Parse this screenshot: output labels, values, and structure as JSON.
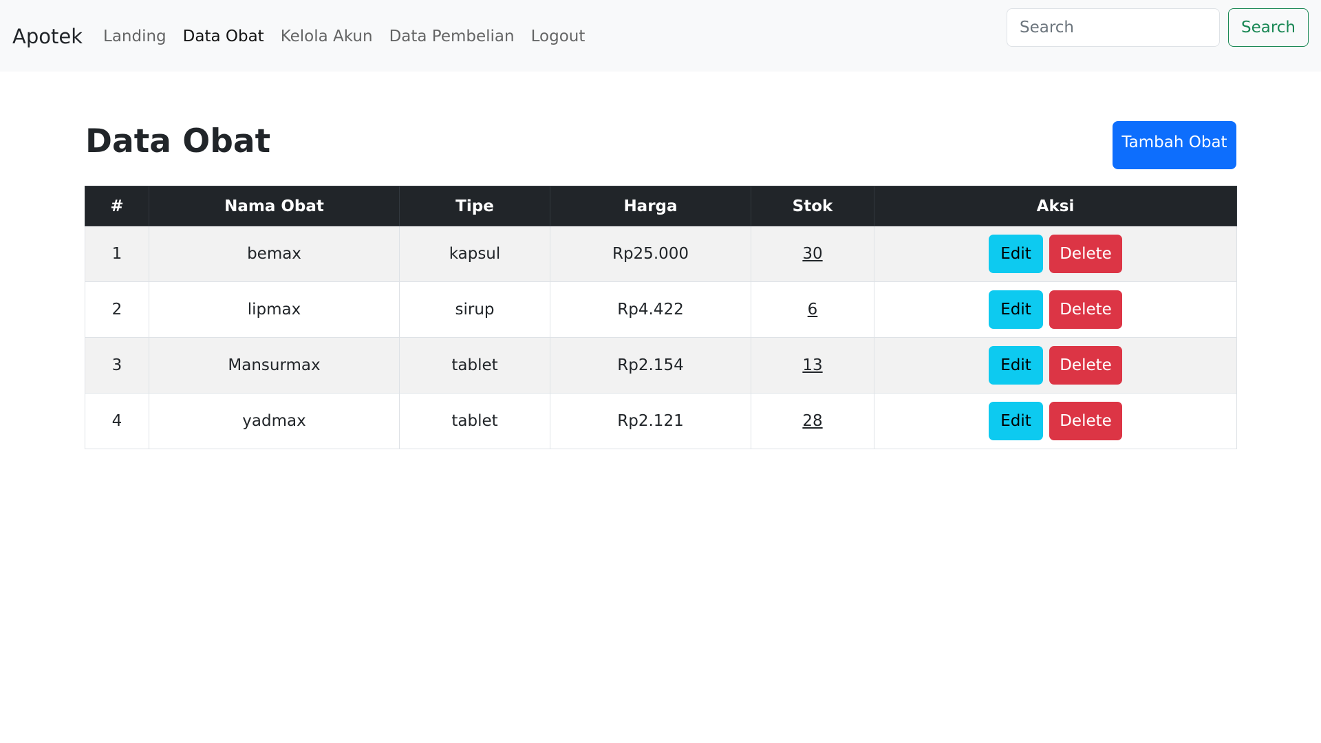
{
  "navbar": {
    "brand": "Apotek",
    "links": [
      {
        "label": "Landing",
        "active": false
      },
      {
        "label": "Data Obat",
        "active": true
      },
      {
        "label": "Kelola Akun",
        "active": false
      },
      {
        "label": "Data Pembelian",
        "active": false
      },
      {
        "label": "Logout",
        "active": false
      }
    ],
    "search_placeholder": "Search",
    "search_button": "Search"
  },
  "main": {
    "title": "Data Obat",
    "add_button": "Tambah Obat"
  },
  "table": {
    "headers": [
      "#",
      "Nama Obat",
      "Tipe",
      "Harga",
      "Stok",
      "Aksi"
    ],
    "rows": [
      {
        "no": "1",
        "nama": "bemax",
        "tipe": "kapsul",
        "harga": "Rp25.000",
        "stok": "30"
      },
      {
        "no": "2",
        "nama": "lipmax",
        "tipe": "sirup",
        "harga": "Rp4.422",
        "stok": "6"
      },
      {
        "no": "3",
        "nama": "Mansurmax",
        "tipe": "tablet",
        "harga": "Rp2.154",
        "stok": "13"
      },
      {
        "no": "4",
        "nama": "yadmax",
        "tipe": "tablet",
        "harga": "Rp2.121",
        "stok": "28"
      }
    ],
    "edit_label": "Edit",
    "delete_label": "Delete"
  },
  "colors": {
    "primary": "#0d6efd",
    "info": "#0dcaf0",
    "danger": "#dc3545",
    "success": "#198754",
    "dark": "#212529"
  }
}
